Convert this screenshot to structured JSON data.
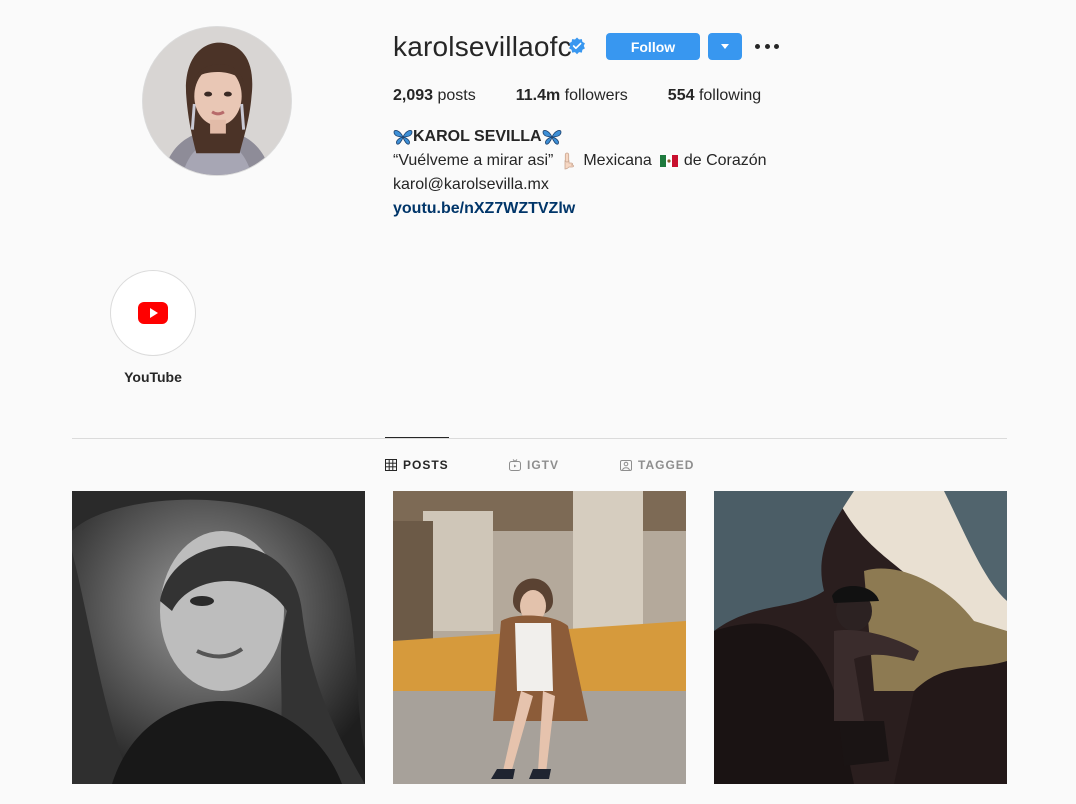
{
  "profile": {
    "username": "karolsevillaofc",
    "follow_label": "Follow",
    "stats": {
      "posts_count": "2,093",
      "posts_label": " posts",
      "followers_count": "11.4m",
      "followers_label": " followers",
      "following_count": "554",
      "following_label": " following"
    },
    "bio": {
      "name": "KAROL SEVILLA",
      "line1_a": "“Vuélveme a mirar asi”",
      "line1_b": "Mexicana",
      "line1_c": "de Corazón",
      "email": "karol@karolsevilla.mx",
      "link": "youtu.be/nXZ7WZTVZlw"
    }
  },
  "highlights": [
    {
      "label": "YouTube",
      "icon": "youtube-icon"
    }
  ],
  "tabs": [
    {
      "label": "POSTS",
      "icon": "grid-icon",
      "active": true
    },
    {
      "label": "IGTV",
      "icon": "igtv-icon",
      "active": false
    },
    {
      "label": "TAGGED",
      "icon": "tagged-icon",
      "active": false
    }
  ],
  "colors": {
    "accent": "#3897f0",
    "verified": "#3897f0",
    "link": "#003569",
    "background": "#fafafa"
  }
}
